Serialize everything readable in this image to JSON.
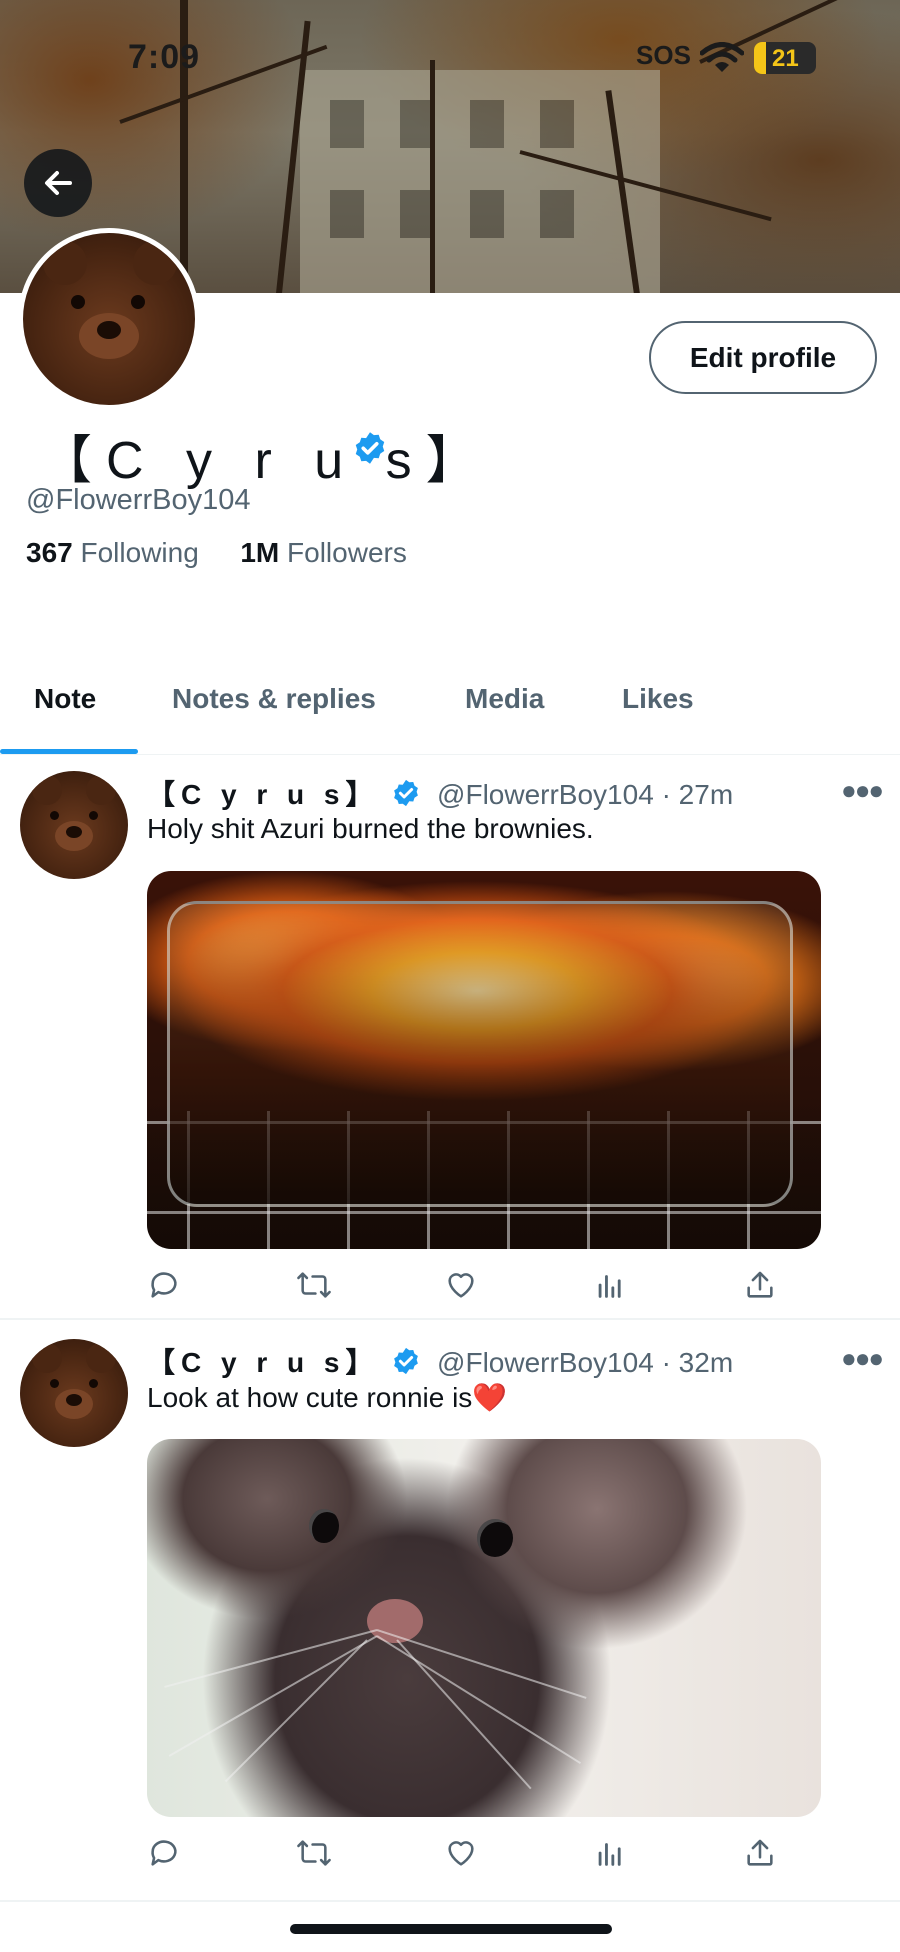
{
  "status_bar": {
    "time": "7:09",
    "carrier": "SOS",
    "battery": "21",
    "battery_level": 0.21
  },
  "header": {
    "back_icon": "arrow-left-icon",
    "edit_profile_label": "Edit profile"
  },
  "profile": {
    "display_name": "【C y r u s】",
    "handle": "@FlowerrBoy104",
    "verified": true,
    "following_count": "367",
    "following_label": "Following",
    "followers_count": "1M",
    "followers_label": "Followers"
  },
  "tabs": [
    {
      "label": "Note",
      "active": true
    },
    {
      "label": "Notes & replies",
      "active": false
    },
    {
      "label": "Media",
      "active": false
    },
    {
      "label": "Likes",
      "active": false
    }
  ],
  "posts": [
    {
      "author": "【C y r u s】",
      "handle": "@FlowerrBoy104",
      "separator": "·",
      "time": "27m",
      "text": "Holy shit Azuri burned the brownies.",
      "media": "image-brownies-on-fire",
      "more_icon": "ellipsis-icon"
    },
    {
      "author": "【C y r u s】",
      "handle": "@FlowerrBoy104",
      "separator": "·",
      "time": "32m",
      "text": "Look at how cute ronnie is❤️",
      "media": "image-rat-closeup",
      "more_icon": "ellipsis-icon"
    }
  ],
  "actions": [
    "reply-icon",
    "repost-icon",
    "like-icon",
    "views-icon",
    "share-icon"
  ],
  "colors": {
    "accent": "#1d9bf0",
    "text_primary": "#0f1419",
    "text_secondary": "#536471",
    "divider": "#eff3f4"
  }
}
